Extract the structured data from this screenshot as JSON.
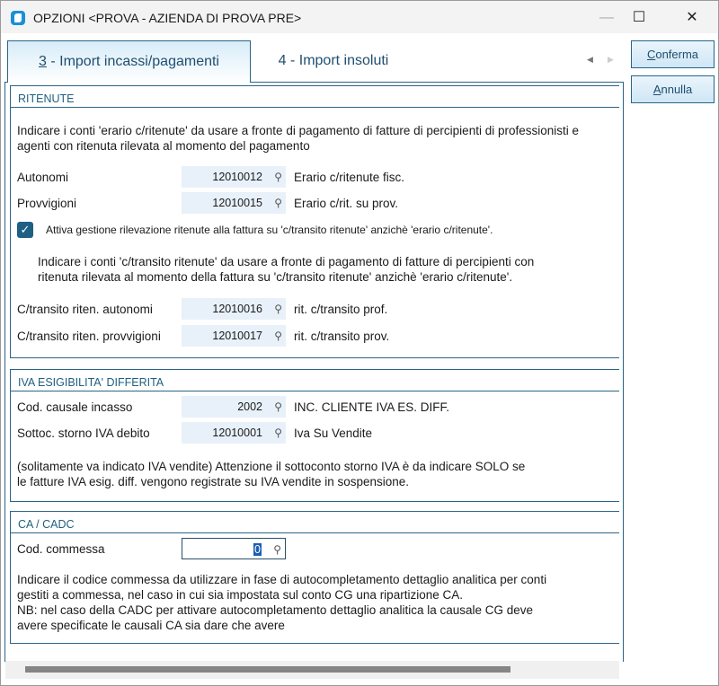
{
  "window": {
    "title": "OPZIONI <PROVA - AZIENDA DI PROVA PRE>",
    "minimize": "—",
    "maximize": "☐",
    "close": "✕"
  },
  "tabs": [
    {
      "key": "3",
      "label": " - Import incassi/pagamenti"
    },
    {
      "label": "4 - Import insoluti"
    }
  ],
  "tabnav": {
    "prev": "◀",
    "next": "▶"
  },
  "buttons": {
    "confirm_key": "C",
    "confirm_rest": "onferma",
    "cancel_key": "A",
    "cancel_rest": "nnulla"
  },
  "ritenute": {
    "header": "RITENUTE",
    "intro1": "Indicare i conti 'erario c/ritenute' da usare a fronte di pagamento di fatture di percipienti di professionisti e",
    "intro2": "agenti con ritenuta rilevata al momento del pagamento",
    "rows": [
      {
        "label": "Autonomi",
        "value": "12010012",
        "desc": "Erario c/ritenute fisc."
      },
      {
        "label": "Provvigioni",
        "value": "12010015",
        "desc": "Erario c/rit. su prov."
      }
    ],
    "checkbox": {
      "checked": true,
      "label": "Attiva gestione rilevazione ritenute alla fattura su 'c/transito ritenute' anzichè 'erario c/ritenute'."
    },
    "note1": "Indicare i conti 'c/transito ritenute' da usare a fronte di pagamento di fatture di percipienti con",
    "note2": "ritenuta rilevata al momento della fattura su  'c/transito ritenute' anzichè 'erario c/ritenute'.",
    "rows2": [
      {
        "label": "C/transito riten. autonomi",
        "value": "12010016",
        "desc": "rit. c/transito prof."
      },
      {
        "label": "C/transito riten. provvigioni",
        "value": "12010017",
        "desc": "rit. c/transito prov."
      }
    ]
  },
  "iva": {
    "header": "IVA ESIGIBILITA' DIFFERITA",
    "rows": [
      {
        "label": "Cod. causale incasso",
        "value": "2002",
        "desc": "INC. CLIENTE IVA ES. DIFF."
      },
      {
        "label": "Sottoc. storno IVA debito",
        "value": "12010001",
        "desc": "Iva Su Vendite"
      }
    ],
    "note1": "(solitamente va indicato IVA vendite) Attenzione il sottoconto storno IVA è da indicare SOLO se",
    "note2": "le fatture IVA esig. diff. vengono registrate su IVA vendite in sospensione."
  },
  "ca": {
    "header": "CA / CADC",
    "label": "Cod. commessa",
    "value": "0",
    "lines": [
      "Indicare il codice commessa da utilizzare in fase di autocompletamento dettaglio analitica per conti",
      "gestiti a commessa, nel caso in cui sia impostata sul conto CG una ripartizione CA.",
      "NB: nel caso della CADC per attivare autocompletamento dettaglio analitica  la causale CG deve",
      "avere specificate le causali CA sia dare che avere"
    ]
  },
  "search_glyph": "⚲"
}
